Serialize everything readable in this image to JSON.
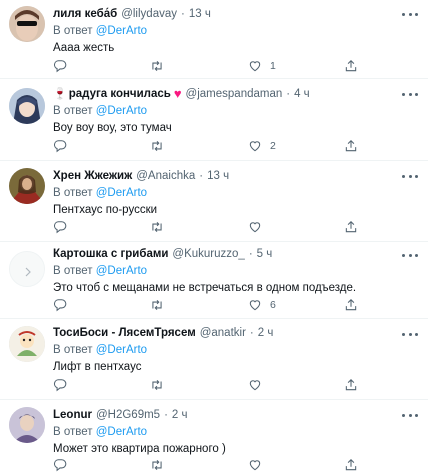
{
  "reply_prefix": "В ответ",
  "tweets": [
    {
      "name": "лиля кеба́б",
      "handle": "@lilydavay",
      "time": "13 ч",
      "emoji": "",
      "heart": false,
      "reply_to": "@DerArto",
      "text": "Аааа жесть",
      "replies": "",
      "retweets": "",
      "likes": "1",
      "avatar": "avatar-sunglasses"
    },
    {
      "name": "радуга кончилась",
      "handle": "@jamespandaman",
      "time": "4 ч",
      "emoji": "🍷",
      "heart": true,
      "reply_to": "@DerArto",
      "text": "Воу воу воу, это тумач",
      "replies": "",
      "retweets": "",
      "likes": "2",
      "avatar": "avatar-anime"
    },
    {
      "name": "Хрен Жжежиж",
      "handle": "@Anaichka",
      "time": "13 ч",
      "emoji": "",
      "heart": false,
      "reply_to": "@DerArto",
      "text": "Пентхаус по-русски",
      "replies": "",
      "retweets": "",
      "likes": "",
      "avatar": "avatar-painting"
    },
    {
      "name": "Картошка с грибами",
      "handle": "@Kukuruzzo_",
      "time": "5 ч",
      "emoji": "",
      "heart": false,
      "reply_to": "@DerArto",
      "text": "Это чтоб с мещанами не встречаться в одном подъезде.",
      "replies": "",
      "retweets": "",
      "likes": "6",
      "avatar": "avatar-blank"
    },
    {
      "name": "ТосиБоси - ЛясемТрясем",
      "handle": "@anatkir",
      "time": "2 ч",
      "emoji": "",
      "heart": false,
      "reply_to": "@DerArto",
      "text": "Лифт в пентхаус",
      "replies": "",
      "retweets": "",
      "likes": "",
      "avatar": "avatar-cartoon"
    },
    {
      "name": "Leonur",
      "handle": "@H2G69m5",
      "time": "2 ч",
      "emoji": "",
      "heart": false,
      "reply_to": "@DerArto",
      "text": "Может это квартира пожарного )",
      "replies": "",
      "retweets": "",
      "likes": "",
      "avatar": "avatar-character"
    }
  ]
}
